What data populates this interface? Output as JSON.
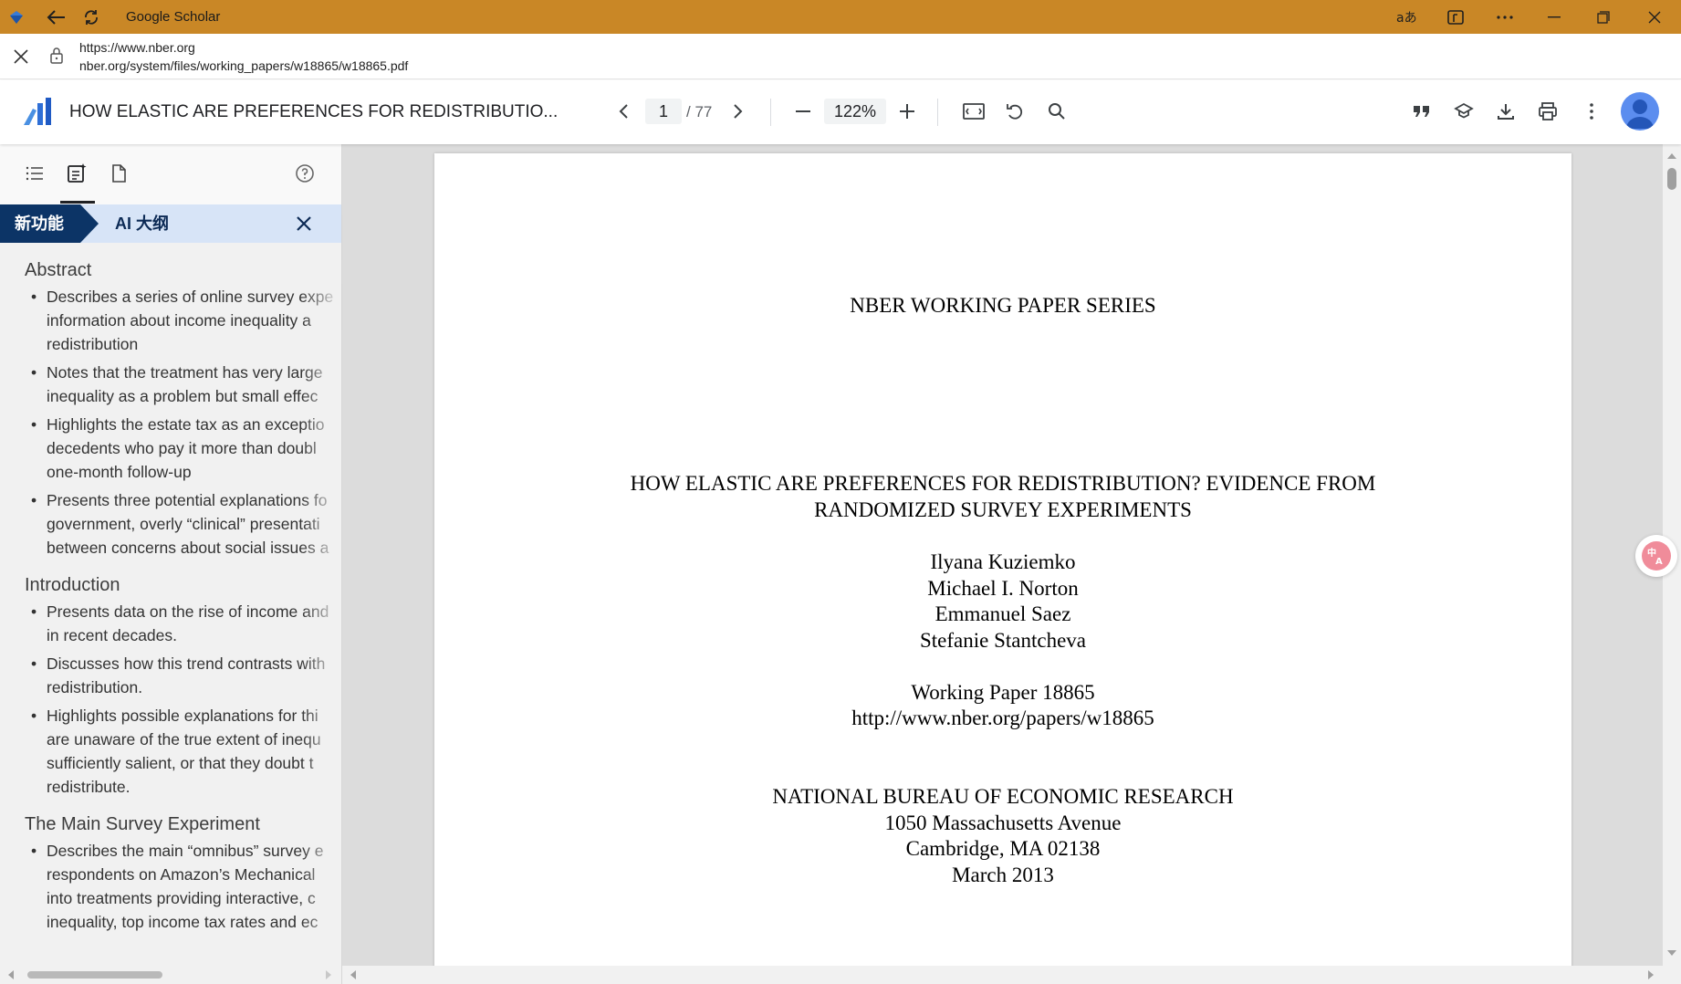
{
  "browser": {
    "title": "Google Scholar",
    "url_host": "https://www.nber.org",
    "url_path": "nber.org/system/files/working_papers/w18865/w18865.pdf",
    "accent": "#c98726"
  },
  "pdf_toolbar": {
    "title": "HOW ELASTIC ARE PREFERENCES FOR REDISTRIBUTIO...",
    "page_current": "1",
    "page_total": "/ 77",
    "zoom": "122%"
  },
  "sidebar": {
    "banner_new": "新功能",
    "banner_title": "AI 大纲",
    "sections": [
      {
        "heading": "Abstract",
        "items": [
          [
            "Describes a series of online survey expe",
            "information about income inequality a",
            "redistribution"
          ],
          [
            "Notes that the treatment has very large",
            "inequality as a problem but small effec"
          ],
          [
            "Highlights the estate tax as an exceptio",
            "decedents who pay it more than doubl",
            "one-month follow-up"
          ],
          [
            "Presents three potential explanations fo",
            "government, overly “clinical” presentati",
            "between concerns about social issues a"
          ]
        ]
      },
      {
        "heading": "Introduction",
        "items": [
          [
            "Presents data on the rise of income and",
            "in recent decades."
          ],
          [
            "Discusses how this trend contrasts with",
            "redistribution."
          ],
          [
            "Highlights possible explanations for thi",
            "are unaware of the true extent of inequ",
            "sufficiently salient, or that they doubt t",
            "redistribute."
          ]
        ]
      },
      {
        "heading": "The Main Survey Experiment",
        "items": [
          [
            "Describes the main “omnibus” survey e",
            "respondents on Amazon’s Mechanical",
            "into treatments providing interactive, c",
            "inequality, top income tax rates and ec"
          ]
        ]
      }
    ]
  },
  "document": {
    "series": "NBER WORKING PAPER SERIES",
    "title_line1": "HOW ELASTIC ARE PREFERENCES FOR REDISTRIBUTION? EVIDENCE FROM",
    "title_line2": "RANDOMIZED SURVEY EXPERIMENTS",
    "authors": [
      "Ilyana Kuziemko",
      "Michael I. Norton",
      "Emmanuel Saez",
      "Stefanie Stantcheva"
    ],
    "working_paper": "Working Paper 18865",
    "paper_url": "http://www.nber.org/papers/w18865",
    "org": "NATIONAL BUREAU OF ECONOMIC RESEARCH",
    "address1": "1050 Massachusetts Avenue",
    "address2": "Cambridge, MA 02138",
    "date": "March 2013"
  }
}
